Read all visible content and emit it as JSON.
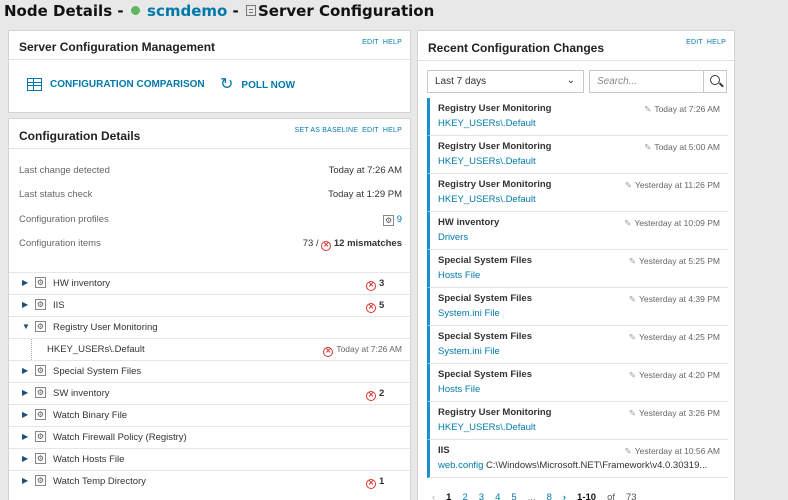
{
  "header": {
    "prefix": "Node Details - ",
    "node_name": "scmdemo",
    "separator": " - ",
    "view_name": "Server Configuration",
    "node_status_color": "#5cb85c"
  },
  "scm": {
    "title": "Server Configuration Management",
    "actions": [
      "EDIT",
      "HELP"
    ],
    "comparison_label": "CONFIGURATION COMPARISON",
    "poll_label": "POLL NOW"
  },
  "details": {
    "title": "Configuration Details",
    "actions": [
      "SET AS BASELINE",
      "EDIT",
      "HELP"
    ],
    "last_change_label": "Last change detected",
    "last_change_value": "Today at 7:26 AM",
    "last_status_label": "Last status check",
    "last_status_value": "Today at 1:29 PM",
    "profiles_label": "Configuration profiles",
    "profiles_value": "9",
    "items_label": "Configuration items",
    "items_value": "73 /",
    "mismatches_value": "12 mismatches",
    "tree": [
      {
        "label": "HW inventory",
        "count": "3",
        "expanded": false
      },
      {
        "label": "IIS",
        "count": "5",
        "expanded": false
      },
      {
        "label": "Registry User Monitoring",
        "count": "",
        "expanded": true
      },
      {
        "label": "Special System Files",
        "count": "",
        "expanded": false
      },
      {
        "label": "SW inventory",
        "count": "2",
        "expanded": false
      },
      {
        "label": "Watch Binary File",
        "count": "",
        "expanded": false
      },
      {
        "label": "Watch Firewall Policy (Registry)",
        "count": "",
        "expanded": false
      },
      {
        "label": "Watch Hosts File",
        "count": "",
        "expanded": false
      },
      {
        "label": "Watch Temp Directory",
        "count": "1",
        "expanded": false
      }
    ],
    "child": {
      "label": "HKEY_USERs\\.Default",
      "time": "Today at 7:26 AM"
    }
  },
  "recent": {
    "title": "Recent Configuration Changes",
    "actions": [
      "EDIT",
      "HELP"
    ],
    "period": "Last 7 days",
    "search_placeholder": "Search...",
    "accent_color": "#1c8fd1",
    "changes": [
      {
        "title": "Registry User Monitoring",
        "detail": "HKEY_USERs\\.Default",
        "detail_extra": "",
        "time": "Today at 7:26 AM"
      },
      {
        "title": "Registry User Monitoring",
        "detail": "HKEY_USERs\\.Default",
        "detail_extra": "",
        "time": "Today at 5:00 AM"
      },
      {
        "title": "Registry User Monitoring",
        "detail": "HKEY_USERs\\.Default",
        "detail_extra": "",
        "time": "Yesterday at 11:26 PM"
      },
      {
        "title": "HW inventory",
        "detail": "Drivers",
        "detail_extra": "",
        "time": "Yesterday at 10:09 PM"
      },
      {
        "title": "Special System Files",
        "detail": "Hosts File",
        "detail_extra": "",
        "time": "Yesterday at 5:25 PM"
      },
      {
        "title": "Special System Files",
        "detail": "System.ini File",
        "detail_extra": "",
        "time": "Yesterday at 4:39 PM"
      },
      {
        "title": "Special System Files",
        "detail": "System.ini File",
        "detail_extra": "",
        "time": "Yesterday at 4:25 PM"
      },
      {
        "title": "Special System Files",
        "detail": "Hosts File",
        "detail_extra": "",
        "time": "Yesterday at 4:20 PM"
      },
      {
        "title": "Registry User Monitoring",
        "detail": "HKEY_USERs\\.Default",
        "detail_extra": "",
        "time": "Yesterday at 3:26 PM"
      },
      {
        "title": "IIS",
        "detail": "web.config",
        "detail_extra": " C:\\Windows\\Microsoft.NET\\Framework\\v4.0.30319...",
        "time": "Yesterday at 10:56 AM"
      }
    ],
    "pager": {
      "prev": "‹",
      "pages": [
        "1",
        "2",
        "3",
        "4",
        "5"
      ],
      "ellipsis": "...",
      "last": "8",
      "next": "›",
      "range": "1-10",
      "of": "of",
      "total": "73"
    }
  }
}
